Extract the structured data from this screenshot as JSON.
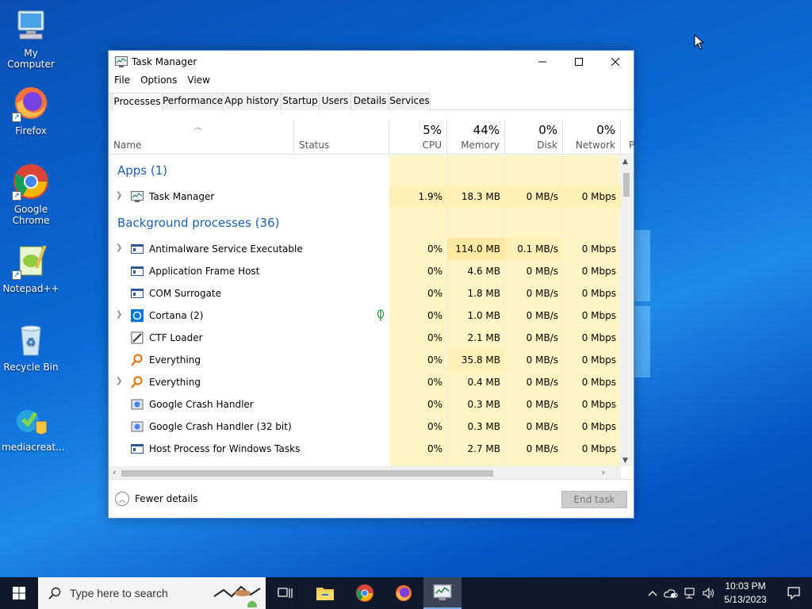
{
  "desktop": {
    "icons": [
      {
        "label": "My Computer"
      },
      {
        "label": "Firefox"
      },
      {
        "label": "Google Chrome"
      },
      {
        "label": "Notepad++"
      },
      {
        "label": "Recycle Bin"
      },
      {
        "label": "mediacreat..."
      }
    ]
  },
  "window": {
    "title": "Task Manager",
    "menu": [
      "File",
      "Options",
      "View"
    ],
    "tabs": [
      "Processes",
      "Performance",
      "App history",
      "Startup",
      "Users",
      "Details",
      "Services"
    ],
    "active_tab": "Processes",
    "columns": {
      "name": "Name",
      "status": "Status",
      "cpu": {
        "pct": "5%",
        "label": "CPU"
      },
      "memory": {
        "pct": "44%",
        "label": "Memory"
      },
      "disk": {
        "pct": "0%",
        "label": "Disk"
      },
      "network": {
        "pct": "0%",
        "label": "Network"
      },
      "more": "P"
    },
    "groups": {
      "apps": "Apps (1)",
      "background": "Background processes (36)"
    },
    "apps": [
      {
        "name": "Task Manager",
        "cpu": "1.9%",
        "memory": "18.3 MB",
        "disk": "0 MB/s",
        "network": "0 Mbps"
      }
    ],
    "processes": [
      {
        "name": "Antimalware Service Executable",
        "cpu": "0%",
        "memory": "114.0 MB",
        "disk": "0.1 MB/s",
        "network": "0 Mbps"
      },
      {
        "name": "Application Frame Host",
        "cpu": "0%",
        "memory": "4.6 MB",
        "disk": "0 MB/s",
        "network": "0 Mbps"
      },
      {
        "name": "COM Surrogate",
        "cpu": "0%",
        "memory": "1.8 MB",
        "disk": "0 MB/s",
        "network": "0 Mbps"
      },
      {
        "name": "Cortana (2)",
        "cpu": "0%",
        "memory": "1.0 MB",
        "disk": "0 MB/s",
        "network": "0 Mbps"
      },
      {
        "name": "CTF Loader",
        "cpu": "0%",
        "memory": "2.1 MB",
        "disk": "0 MB/s",
        "network": "0 Mbps"
      },
      {
        "name": "Everything",
        "cpu": "0%",
        "memory": "35.8 MB",
        "disk": "0 MB/s",
        "network": "0 Mbps"
      },
      {
        "name": "Everything",
        "cpu": "0%",
        "memory": "0.4 MB",
        "disk": "0 MB/s",
        "network": "0 Mbps"
      },
      {
        "name": "Google Crash Handler",
        "cpu": "0%",
        "memory": "0.3 MB",
        "disk": "0 MB/s",
        "network": "0 Mbps"
      },
      {
        "name": "Google Crash Handler (32 bit)",
        "cpu": "0%",
        "memory": "0.3 MB",
        "disk": "0 MB/s",
        "network": "0 Mbps"
      },
      {
        "name": "Host Process for Windows Tasks",
        "cpu": "0%",
        "memory": "2.7 MB",
        "disk": "0 MB/s",
        "network": "0 Mbps"
      }
    ],
    "footer": {
      "fewer_details": "Fewer details",
      "end_task": "End task"
    }
  },
  "taskbar": {
    "search_placeholder": "Type here to search",
    "time": "10:03 PM",
    "date": "5/13/2023"
  },
  "colors": {
    "desktop_blue": "#0a6ad6",
    "heat_light": "#fff4c4",
    "heat_medium": "#ffe8a0",
    "taskbar": "#101a2b",
    "group_text": "#1e5fb0"
  }
}
